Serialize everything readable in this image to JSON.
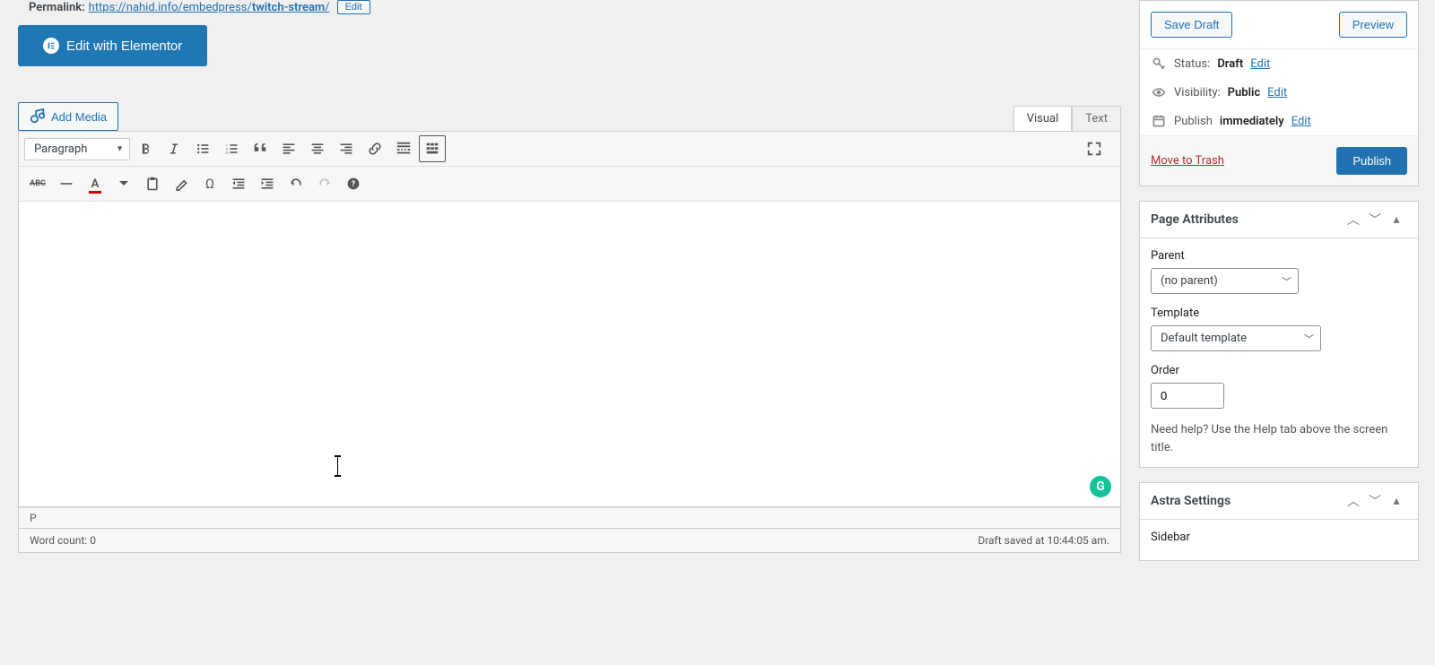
{
  "permalink": {
    "label": "Permalink:",
    "base": "https://nahid.info/embedpress/",
    "slug": "twitch-stream",
    "trail": "/",
    "edit_label": "Edit"
  },
  "elementor_button": "Edit with Elementor",
  "add_media": "Add Media",
  "editor_tabs": {
    "visual": "Visual",
    "text": "Text"
  },
  "format_dropdown": "Paragraph",
  "status_path": "P",
  "word_count_label": "Word count: ",
  "word_count": "0",
  "draft_saved": "Draft saved at 10:44:05 am.",
  "publish_box": {
    "save_draft": "Save Draft",
    "preview": "Preview",
    "status_label": "Status:",
    "status_value": "Draft",
    "status_edit": "Edit",
    "visibility_label": "Visibility:",
    "visibility_value": "Public",
    "visibility_edit": "Edit",
    "publish_label": "Publish",
    "publish_value": "immediately",
    "publish_edit": "Edit",
    "trash": "Move to Trash",
    "publish_button": "Publish"
  },
  "page_attributes": {
    "title": "Page Attributes",
    "parent_label": "Parent",
    "parent_value": "(no parent)",
    "template_label": "Template",
    "template_value": "Default template",
    "order_label": "Order",
    "order_value": "0",
    "help_text": "Need help? Use the Help tab above the screen title."
  },
  "astra": {
    "title": "Astra Settings",
    "sidebar_label": "Sidebar"
  },
  "grammarly_glyph": "G"
}
